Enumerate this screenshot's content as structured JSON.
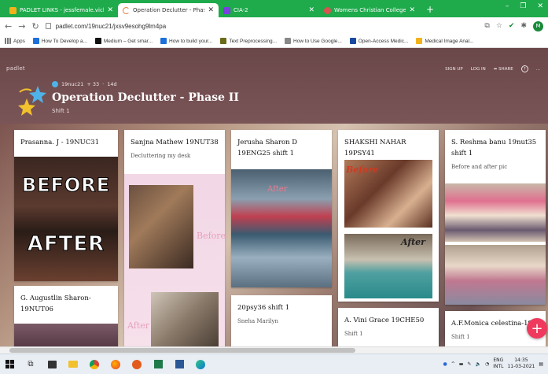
{
  "browser": {
    "tabs": [
      {
        "label": "PADLET LINKS - jessfemale.vicki",
        "active": false,
        "color": "#f2b21a"
      },
      {
        "label": "Operation Declutter - Phase II",
        "active": true,
        "color": "#e07a3c"
      },
      {
        "label": "CIA-2",
        "active": false,
        "color": "#7b3fe4"
      },
      {
        "label": "Womens Christian College WA-I",
        "active": false,
        "color": "#d9534f"
      }
    ],
    "new_tab": "+",
    "window_controls": [
      "–",
      "❐",
      "✕"
    ],
    "url": "padlet.com/19nuc21/jxsv9esohg9lm4pa",
    "bookmarks": [
      {
        "label": "Apps",
        "color": "#777"
      },
      {
        "label": "How To Develop a...",
        "color": "#1e6fd9"
      },
      {
        "label": "Medium – Get smar...",
        "color": "#111"
      },
      {
        "label": "How to build your...",
        "color": "#1e6fd9"
      },
      {
        "label": "Text Preprocessing...",
        "color": "#3a3a3a"
      },
      {
        "label": "How to Use Google...",
        "color": "#888"
      },
      {
        "label": "Open-Access Medic...",
        "color": "#1a4aa0"
      },
      {
        "label": "Medical Image Anal...",
        "color": "#f2b21a"
      }
    ]
  },
  "padlet": {
    "logo": "padlet",
    "menu": [
      "SIGN UP",
      "LOG IN",
      "SHARE",
      "?",
      "..."
    ],
    "author": "19nuc21",
    "stats": "+ 33",
    "age": "14d",
    "title": "Operation Declutter - Phase II",
    "subtitle": "Shift 1"
  },
  "cards": [
    {
      "title": "Prasanna. J - 19NUC31",
      "body": "",
      "overlay_top": "BEFORE",
      "overlay_bottom": "AFTER"
    },
    {
      "title": "G. Augustlin Sharon-19NUT06",
      "body": ""
    },
    {
      "title": "Sanjna Mathew 19NUT38",
      "body": "Decluttering my desk",
      "label_before": "Before",
      "label_after": "After"
    },
    {
      "title": "Jerusha Sharon D 19ENG25 shift 1",
      "body": "",
      "label_after": "After"
    },
    {
      "title": "20psy36 shift 1",
      "body": "Sneha Marilyn"
    },
    {
      "title": "SHAKSHI NAHAR 19PSY41",
      "body": "",
      "label_before": "Before",
      "label_after": "After"
    },
    {
      "title": "A. Vini Grace 19CHE50",
      "body": "Shift 1"
    },
    {
      "title": "S. Reshma banu 19nut35 shift 1",
      "body": "Before and after pic"
    },
    {
      "title": "A.F.Monica celestina-19che",
      "body": "Shift 1"
    }
  ],
  "fab": "+",
  "taskbar": {
    "lang": "ENG",
    "layout": "INTL",
    "time": "14:35",
    "date": "11-03-2021"
  }
}
